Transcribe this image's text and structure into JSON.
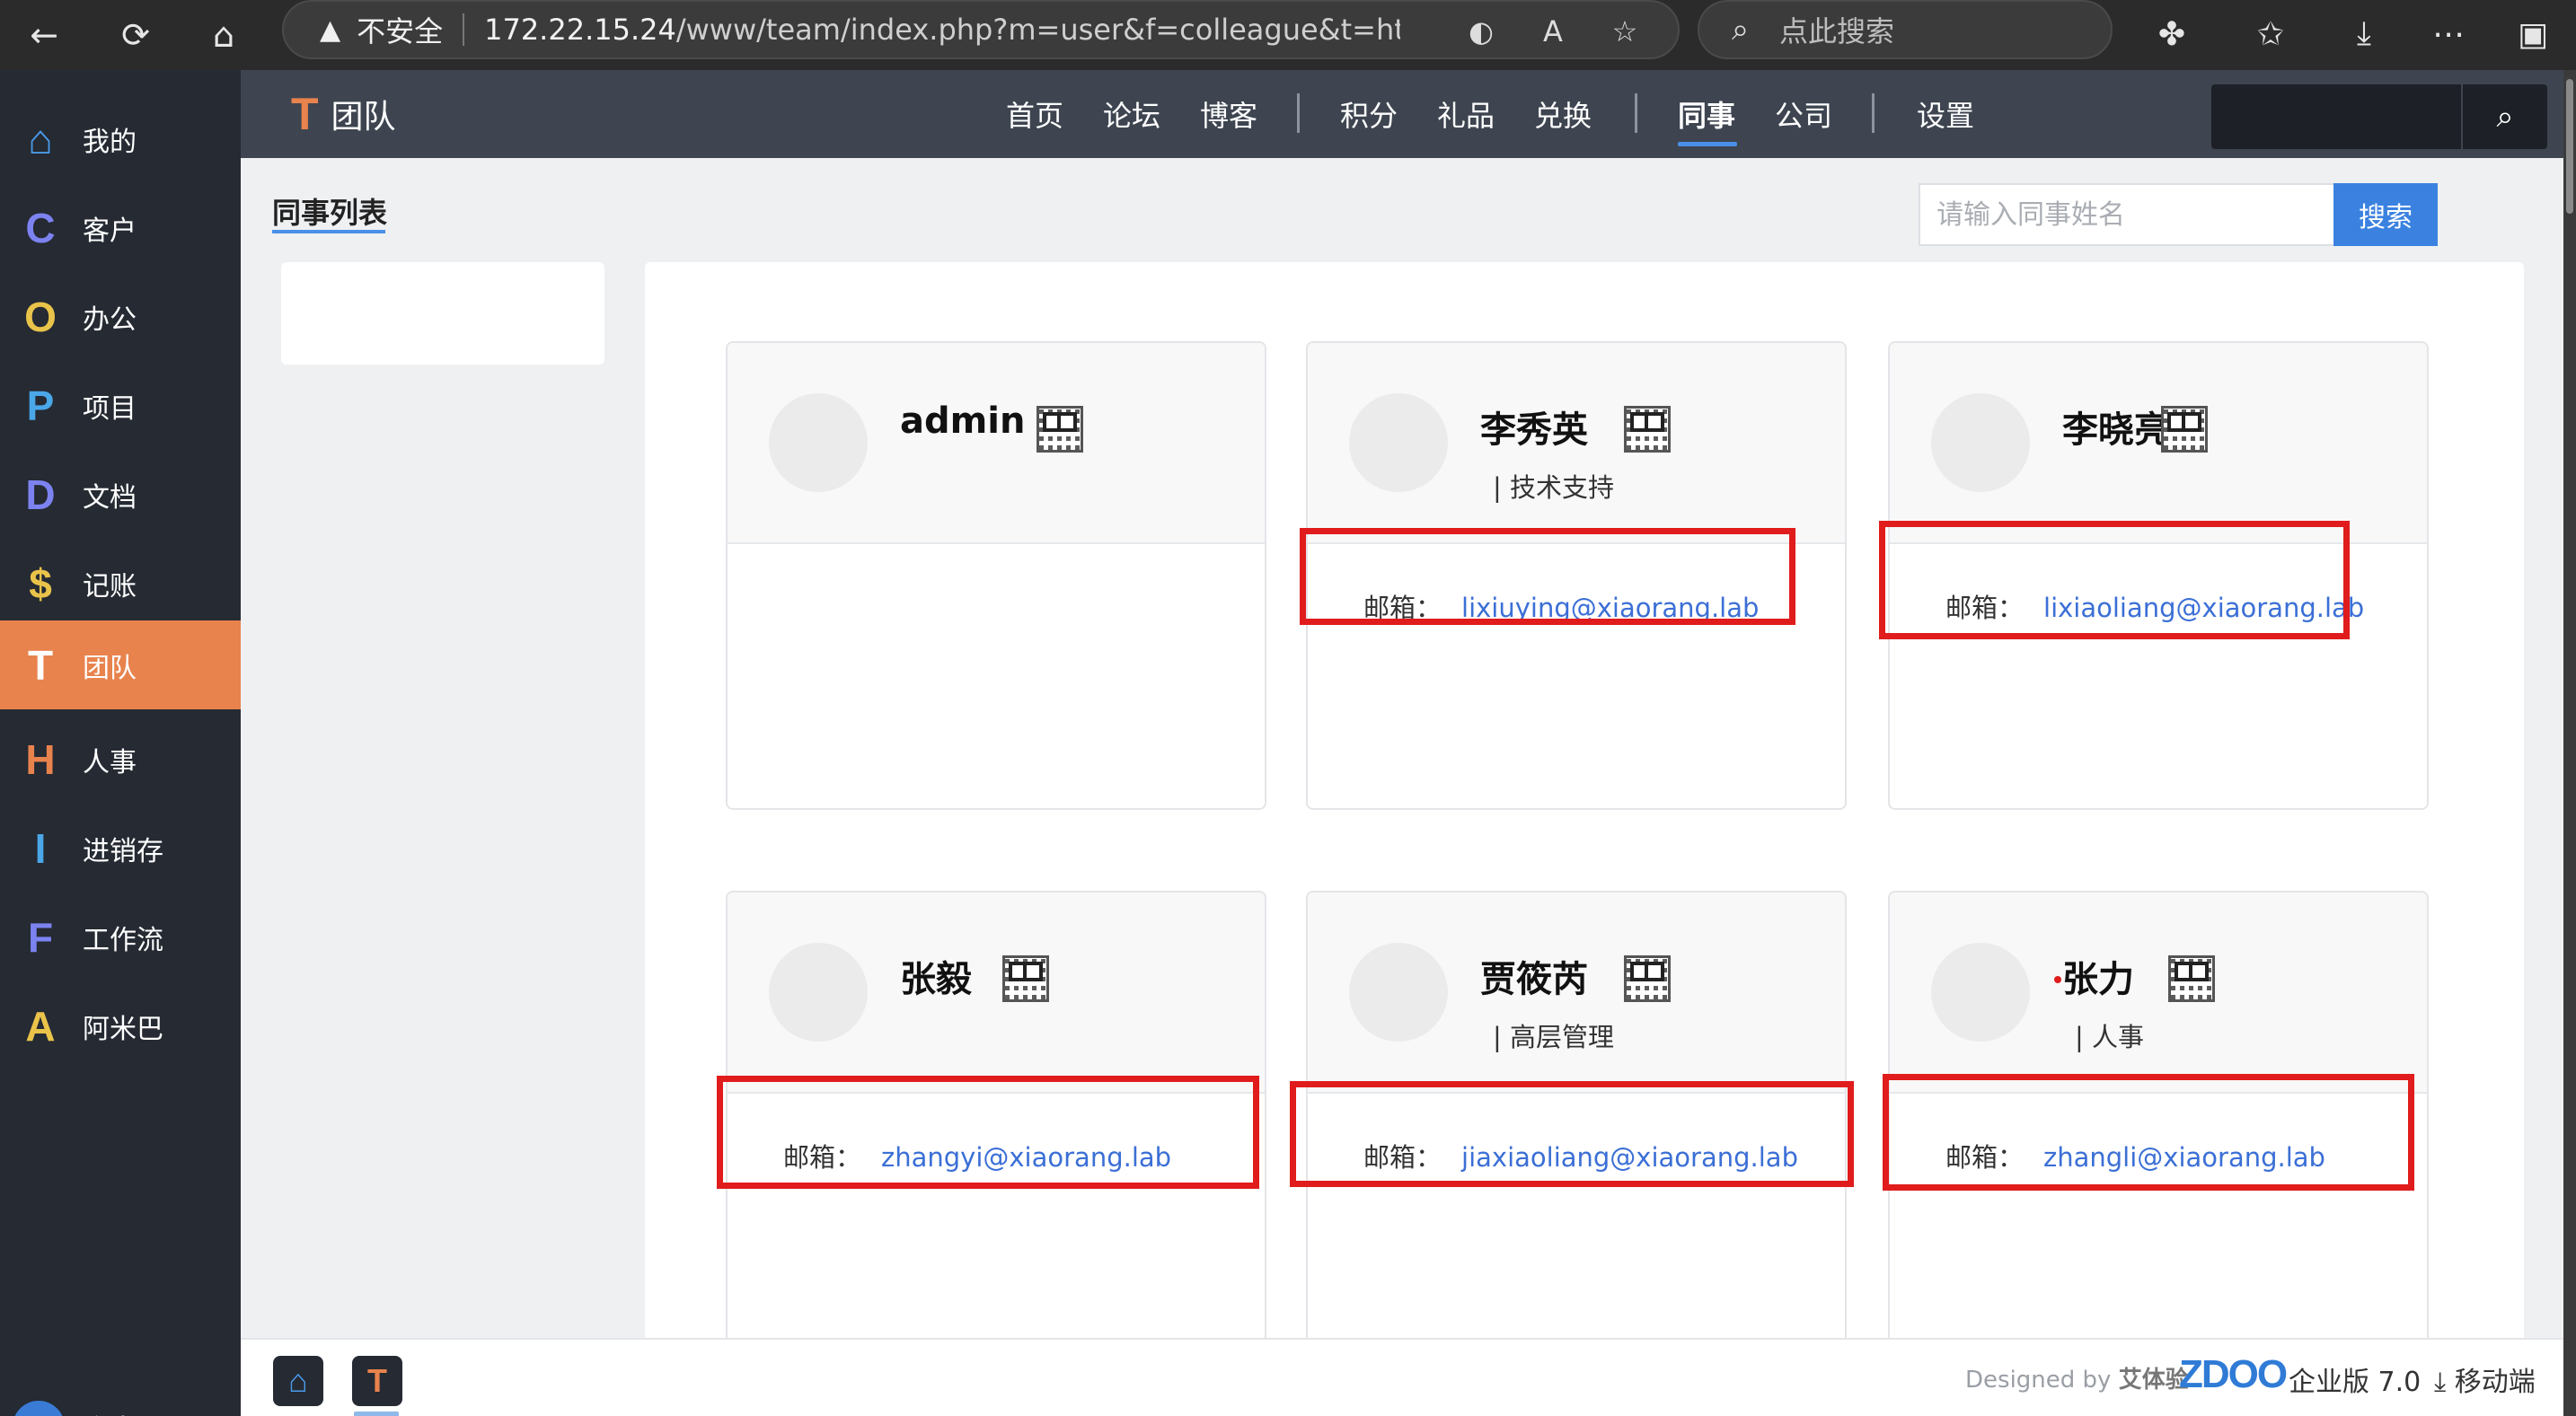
{
  "browser": {
    "back_icon": "←",
    "reload_icon": "⟳",
    "home_icon": "⌂",
    "warning_icon": "▲",
    "insecure_label": "不安全",
    "url_host": "172.22.15.24",
    "url_path": "/www/team/index.php?m=user&f=colleague&t=html&de...",
    "search_placeholder": "点此搜索"
  },
  "sidebar": {
    "items": [
      {
        "icon": "home-icon",
        "glyph": "⌂",
        "label": "我的",
        "color": "#4a9be8"
      },
      {
        "icon": "C",
        "glyph": "C",
        "label": "客户",
        "color": "#7c83f0"
      },
      {
        "icon": "O",
        "glyph": "O",
        "label": "办公",
        "color": "#e9c34a"
      },
      {
        "icon": "P",
        "glyph": "P",
        "label": "项目",
        "color": "#4aa7e8"
      },
      {
        "icon": "D",
        "glyph": "D",
        "label": "文档",
        "color": "#7c83f0"
      },
      {
        "icon": "$",
        "glyph": "$",
        "label": "记账",
        "color": "#e9c34a"
      },
      {
        "icon": "T",
        "glyph": "T",
        "label": "团队",
        "color": "#ffffff"
      },
      {
        "icon": "H",
        "glyph": "H",
        "label": "人事",
        "color": "#e8834d"
      },
      {
        "icon": "I",
        "glyph": "I",
        "label": "进销存",
        "color": "#4aa7e8"
      },
      {
        "icon": "F",
        "glyph": "F",
        "label": "工作流",
        "color": "#7c83f0"
      },
      {
        "icon": "A",
        "glyph": "A",
        "label": "阿米巴",
        "color": "#e9c34a"
      }
    ],
    "active_index": 6,
    "personal_avatar": "A",
    "personal_label": "个人"
  },
  "topnav": {
    "brand_letter": "T",
    "brand_label": "团队",
    "menu": [
      "首页",
      "论坛",
      "博客",
      "积分",
      "礼品",
      "兑换",
      "同事",
      "公司",
      "设置"
    ],
    "active": "同事"
  },
  "content": {
    "page_title": "同事列表",
    "search_placeholder": "请输入同事姓名",
    "search_button": "搜索",
    "email_label": "邮箱：",
    "colleagues": [
      {
        "name": "admin",
        "dept": "",
        "email": ""
      },
      {
        "name": "李秀英",
        "dept": "| 技术支持",
        "email": "lixiuying@xiaorang.lab"
      },
      {
        "name": "李晓亮",
        "dept": "",
        "email": "lixiaoliang@xiaorang.lab"
      },
      {
        "name": "张毅",
        "dept": "",
        "email": "zhangyi@xiaorang.lab"
      },
      {
        "name": "贾筱芮",
        "dept": "| 高层管理",
        "email": "jiaxiaoliang@xiaorang.lab"
      },
      {
        "name": "张力",
        "dept": "| 人事",
        "email": "zhangli@xiaorang.lab"
      }
    ]
  },
  "footer": {
    "designed_by": "Designed by",
    "designer": "艾体验",
    "product_logo": "ZDOO",
    "edition": "企业版 7.0",
    "mobile": "移动端",
    "home_app": "⌂",
    "team_app": "T"
  },
  "colors": {
    "accent": "#e8834d",
    "link": "#3b6fd6",
    "highlight": "#e01c1c",
    "primary_button": "#3b82e0"
  }
}
